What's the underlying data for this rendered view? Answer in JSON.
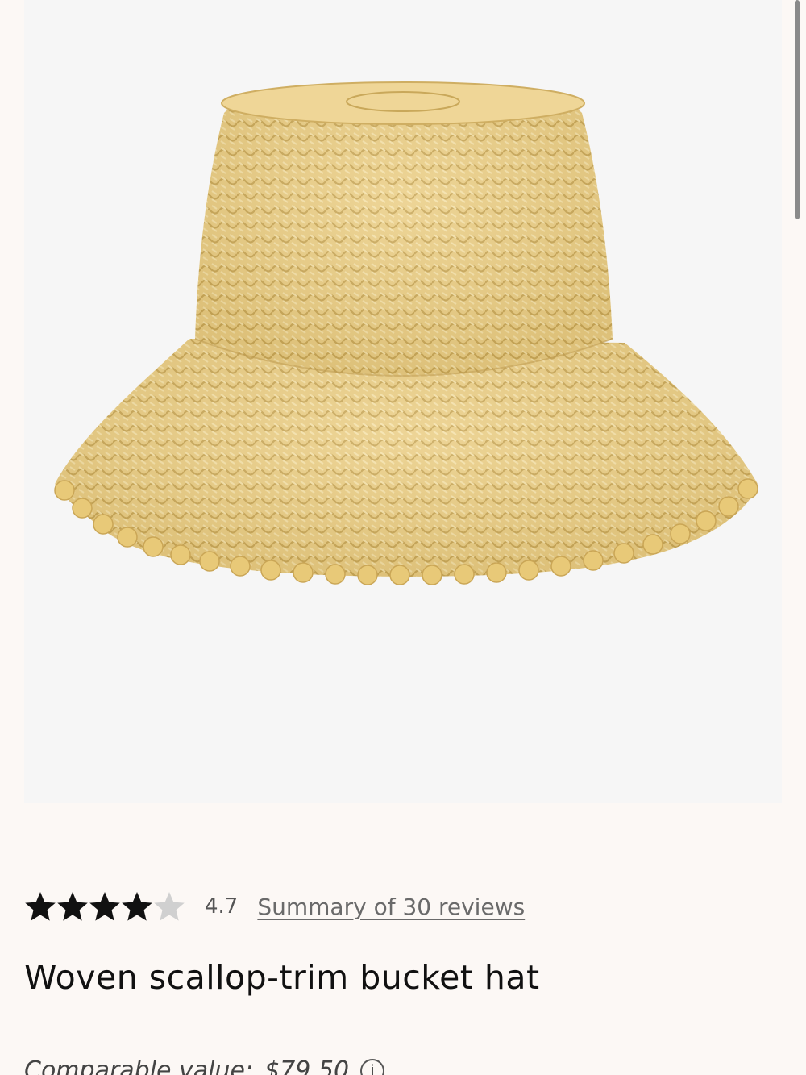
{
  "product": {
    "image_alt": "Woven straw bucket hat with scalloped brim",
    "title": "Woven scallop-trim bucket hat",
    "rating": {
      "value": "4.7",
      "stars_out_of_5": 4.7,
      "reviews_link": "Summary of 30 reviews"
    },
    "comparable": {
      "label": "Comparable value:",
      "price": "$79.50",
      "info_icon": "info-icon"
    }
  },
  "colors": {
    "page_background": "#fcf8f5",
    "image_background": "#f6f6f6",
    "straw": "#eccf85",
    "star": "#111111"
  }
}
